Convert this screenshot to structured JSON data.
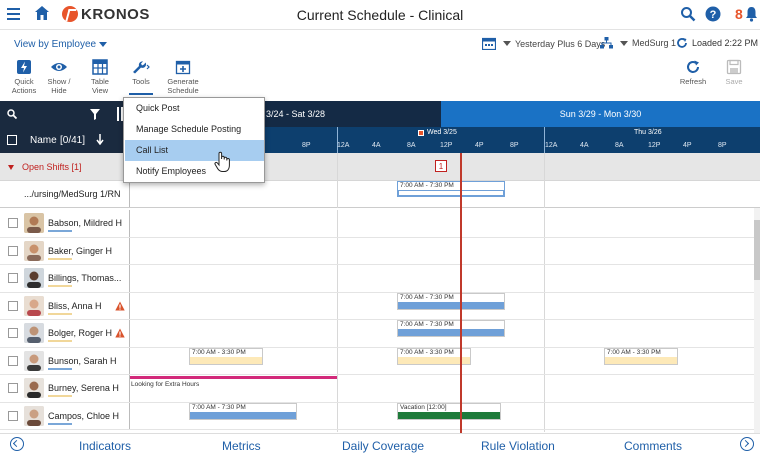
{
  "header": {
    "app_name": "KRONOS",
    "title": "Current Schedule - Clinical",
    "notification_count": "8"
  },
  "subbar": {
    "view_by": "View by Employee",
    "date_range": "Yesterday Plus 6 Days",
    "location": "MedSurg 1",
    "loaded": "Loaded 2:22 PM"
  },
  "toolbar": {
    "quick_actions": "Quick Actions",
    "show_hide": "Show / Hide",
    "table_view": "Table View",
    "tools": "Tools",
    "generate_schedule": "Generate Schedule",
    "refresh": "Refresh",
    "save": "Save"
  },
  "tools_menu": {
    "items": [
      "Quick Post",
      "Manage Schedule Posting",
      "Call List",
      "Notify Employees"
    ],
    "selected": "Call List"
  },
  "grid": {
    "name_header": "Name",
    "count": "[0/41]",
    "week1": "3/24 - Sat 3/28",
    "week2": "Sun 3/29 - Mon 3/30",
    "day1": "Wed 3/25",
    "day2": "Thu 3/26",
    "hours_tail": [
      "4P",
      "8P"
    ],
    "hours": [
      "12A",
      "4A",
      "8A",
      "12P",
      "4P",
      "8P"
    ],
    "open_shifts": "Open Shifts [1]",
    "open_count": "1",
    "open_sub_label": ".../ursing/MedSurg 1/RN",
    "open_shift_time": "7:00 AM - 7:30 PM"
  },
  "employees": [
    {
      "name": "Babson, Mildred H",
      "warn": false
    },
    {
      "name": "Baker, Ginger H",
      "warn": false
    },
    {
      "name": "Billings, Thomas...",
      "warn": false
    },
    {
      "name": "Bliss, Anna H",
      "warn": true
    },
    {
      "name": "Bolger, Roger H",
      "warn": true
    },
    {
      "name": "Bunson, Sarah H",
      "warn": false
    },
    {
      "name": "Burney, Serena H",
      "warn": false
    },
    {
      "name": "Campos, Chloe H",
      "warn": false
    }
  ],
  "shifts": {
    "bliss": "7:00 AM - 7:30 PM",
    "bolger": "7:00 AM - 7:30 PM",
    "bunson_1": "7:00 AM - 3:30 PM",
    "bunson_2": "7:00 AM - 3:30 PM",
    "bunson_3": "7:00 AM - 3:30 PM",
    "burney": "Looking for Extra Hours",
    "campos_1": "7:00 AM - 7:30 PM",
    "campos_2": "Vacation [12:00]"
  },
  "bottom_tabs": [
    "Indicators",
    "Metrics",
    "Daily Coverage",
    "Rule Violation",
    "Comments"
  ],
  "colors": {
    "accent": "#1f5fa8",
    "header_dark": "#1a2a3f",
    "week_blue": "#1a72c5",
    "today_line": "#c0392b",
    "open_shift_red": "#c0211f",
    "bar_blue": "#6fa0d8",
    "bar_yellow": "#fde9b8",
    "bar_green": "#1e7a3a",
    "bar_pink": "#d22a7a"
  }
}
